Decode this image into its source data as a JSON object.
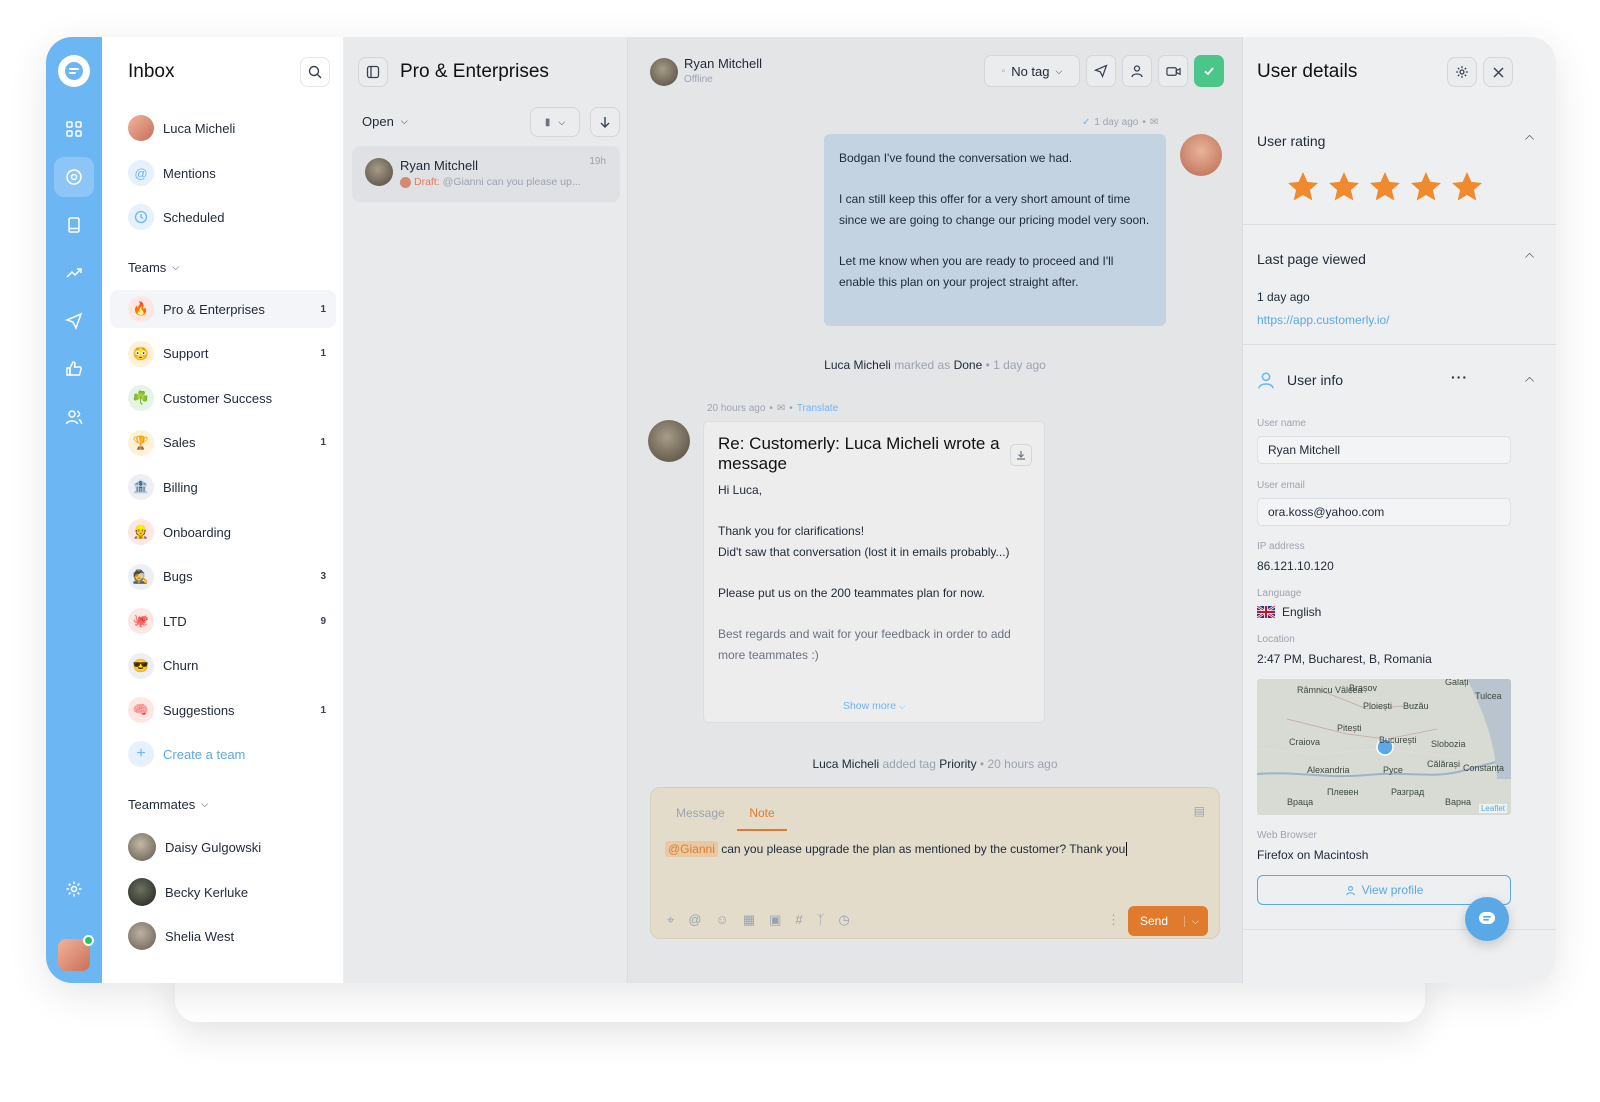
{
  "inbox": {
    "title": "Inbox",
    "top_items": [
      {
        "label": "Luca Micheli"
      },
      {
        "label": "Mentions"
      },
      {
        "label": "Scheduled"
      }
    ],
    "teams_header": "Teams",
    "teams": [
      {
        "label": "Pro & Enterprises",
        "count": "1",
        "emoji": "🔥"
      },
      {
        "label": "Support",
        "count": "1",
        "emoji": "😳"
      },
      {
        "label": "Customer Success",
        "count": "",
        "emoji": "☘️"
      },
      {
        "label": "Sales",
        "count": "1",
        "emoji": "🏆"
      },
      {
        "label": "Billing",
        "count": "",
        "emoji": "🏦"
      },
      {
        "label": "Onboarding",
        "count": "",
        "emoji": "👷"
      },
      {
        "label": "Bugs",
        "count": "3",
        "emoji": "🕵️"
      },
      {
        "label": "LTD",
        "count": "9",
        "emoji": "🐙"
      },
      {
        "label": "Churn",
        "count": "",
        "emoji": "😎"
      },
      {
        "label": "Suggestions",
        "count": "1",
        "emoji": "🧠"
      }
    ],
    "create_team": "Create a team",
    "teammates_header": "Teammates",
    "teammates": [
      {
        "label": "Daisy Gulgowski"
      },
      {
        "label": "Becky Kerluke"
      },
      {
        "label": "Shelia West"
      }
    ]
  },
  "conversations": {
    "title": "Pro & Enterprises",
    "filter": "Open",
    "items": [
      {
        "name": "Ryan Mitchell",
        "time": "19h",
        "draft_label": "Draft:",
        "preview": "@Gianni can you please up..."
      }
    ]
  },
  "chat": {
    "contact_name": "Ryan Mitchell",
    "contact_status": "Offline",
    "tag_button": "No tag",
    "msg1_meta": "1 day ago",
    "msg1_lines": [
      "Bodgan I've found the conversation we had.",
      "I can still keep this offer for a very short amount of time since we are going to change our pricing model very soon.",
      "Let me know when you are ready to proceed and I'll enable this plan on your project straight after."
    ],
    "event1": {
      "actor": "Luca Micheli",
      "action": "marked as",
      "target": "Done",
      "time": "1 day ago"
    },
    "msg2_meta": "20 hours ago",
    "msg2_translate": "Translate",
    "msg2_subject": "Re: Customerly: Luca Micheli wrote a message",
    "msg2_lines": [
      "Hi Luca,",
      "Thank you for clarifications!",
      "Did't saw that conversation (lost it in emails probably...)",
      "Please put us on the 200 teammates plan for now.",
      "Best regards and wait for your feedback in order to add more teammates :)"
    ],
    "show_more": "Show more",
    "event2": {
      "actor": "Luca Micheli",
      "action": "added tag",
      "target": "Priority",
      "time": "20 hours ago"
    },
    "composer": {
      "tab_message": "Message",
      "tab_note": "Note",
      "mention": "@Gianni",
      "text": "can you please upgrade the plan as mentioned by the customer? Thank you",
      "send": "Send"
    }
  },
  "details": {
    "title": "User details",
    "rating_title": "User rating",
    "rating": 5,
    "last_page_title": "Last page viewed",
    "last_page_time": "1 day ago",
    "last_page_url": "https://app.customerly.io/",
    "user_info_title": "User info",
    "fields": {
      "username_label": "User name",
      "username": "Ryan Mitchell",
      "email_label": "User email",
      "email": "ora.koss@yahoo.com",
      "ip_label": "IP address",
      "ip": "86.121.10.120",
      "language_label": "Language",
      "language": "English",
      "location_label": "Location",
      "location": "2:47 PM, Bucharest, B, Romania",
      "browser_label": "Web Browser",
      "browser": "Firefox on Macintosh"
    },
    "map": {
      "labels": [
        "Galați",
        "Tulcea",
        "Brașov",
        "Râmnicu Vâlcea",
        "Ploiești",
        "Buzău",
        "Pitești",
        "București",
        "Craiova",
        "Slobozia",
        "Călărași",
        "Constanța",
        "Alexandria",
        "Русе",
        "Плевен",
        "Разград",
        "Враца",
        "Варна"
      ],
      "attribution": "Leaflet"
    },
    "view_profile": "View profile",
    "colors": {
      "accent": "#5aa9e6",
      "note": "#e07b2e",
      "star": "#ef8a2e",
      "rail": "#6db6f4"
    }
  }
}
